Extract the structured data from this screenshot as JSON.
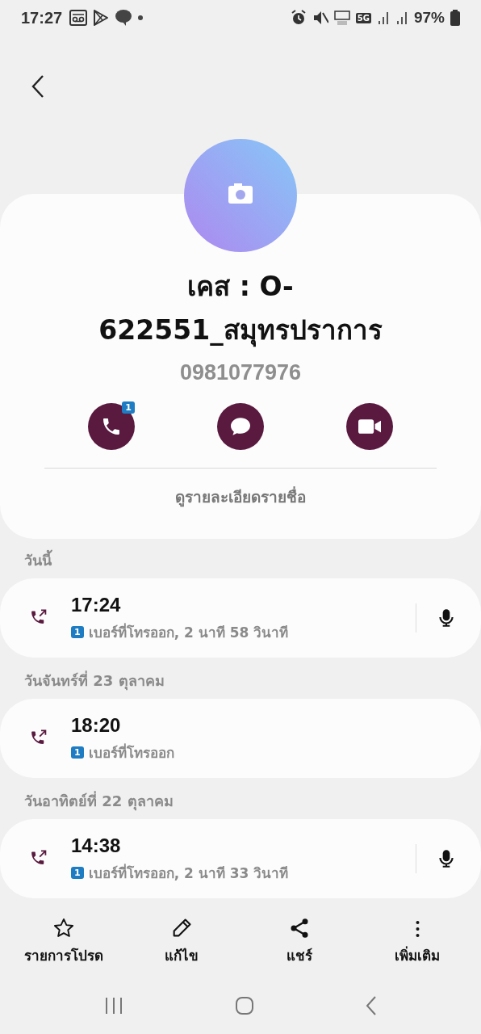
{
  "status_bar": {
    "time": "17:27",
    "network": "5G",
    "battery": "97%"
  },
  "contact": {
    "name": "เคส : O-622551_สมุทรปราการ",
    "phone": "0981077976",
    "call_badge": "1"
  },
  "details_link": "ดูรายละเอียดรายชื่อ",
  "call_groups": [
    {
      "date": "วันนี้",
      "calls": [
        {
          "kind": "outgoing",
          "time": "17:24",
          "sim": "1",
          "detail": "เบอร์ที่โทรออก, 2 นาที 58 วินาที",
          "recording": true
        }
      ]
    },
    {
      "date": "วันจันทร์ที่ 23 ตุลาคม",
      "calls": [
        {
          "kind": "outgoing",
          "time": "18:20",
          "sim": "1",
          "detail": "เบอร์ที่โทรออก",
          "recording": false
        }
      ]
    },
    {
      "date": "วันอาทิตย์ที่ 22 ตุลาคม",
      "calls": [
        {
          "kind": "outgoing",
          "time": "14:38",
          "sim": "1",
          "detail": "เบอร์ที่โทรออก, 2 นาที 33 วินาที",
          "recording": true
        }
      ]
    }
  ],
  "bottom_actions": [
    {
      "kind": "favorite",
      "label": "รายการโปรด"
    },
    {
      "kind": "edit",
      "label": "แก้ไข"
    },
    {
      "kind": "share",
      "label": "แชร์"
    },
    {
      "kind": "more",
      "label": "เพิ่มเติม"
    }
  ]
}
